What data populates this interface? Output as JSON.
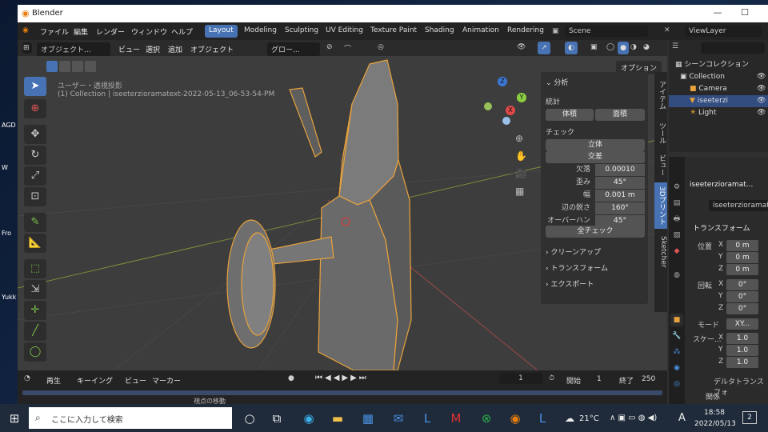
{
  "desktop": {
    "labels": [
      "AGD",
      "W",
      "Fro",
      "Yukk"
    ]
  },
  "window": {
    "title": "Blender",
    "minimize": "—",
    "maximize": "☐"
  },
  "topbar": {
    "menus": [
      "ファイル",
      "編集",
      "レンダー",
      "ウィンドウ",
      "ヘルプ"
    ],
    "workspaces": [
      "Layout",
      "Modeling",
      "Sculpting",
      "UV Editing",
      "Texture Paint",
      "Shading",
      "Animation",
      "Rendering"
    ],
    "active_workspace": "Layout",
    "scene": "Scene",
    "view_layer": "ViewLayer"
  },
  "viewport_header": {
    "mode": "オブジェクト...",
    "menus": [
      "ビュー",
      "選択",
      "追加",
      "オブジェクト"
    ],
    "orientation": "グロー...",
    "options": "オプション"
  },
  "viewport": {
    "overlay_text_1": "ユーザー・透視投影",
    "overlay_text_2": "(1) Collection | iseeterzioramatext-2022-05-13_06-53-54-PM",
    "gizmo": {
      "z": "Z",
      "y": "Y",
      "x": "X"
    }
  },
  "npanel": {
    "section_analysis": "分析",
    "stats_label": "統計",
    "volume_btn": "体積",
    "area_btn": "面積",
    "check_label": "チェック",
    "solid": "立体",
    "intersect": "交差",
    "rows": [
      {
        "label": "欠落",
        "value": "0.00010"
      },
      {
        "label": "歪み",
        "value": "45°"
      },
      {
        "label": "幅",
        "value": "0.001 m"
      },
      {
        "label": "辺の鋭さ",
        "value": "160°"
      },
      {
        "label": "オーバーハング",
        "value": "45°"
      }
    ],
    "check_all": "全チェック",
    "cleanup": "クリーンアップ",
    "transform": "トランスフォーム",
    "export": "エクスポート"
  },
  "ntabs": [
    "アイテム",
    "ツール",
    "ビュー",
    "3Dプリント",
    "Sketcher"
  ],
  "ntabs_active": "3Dプリント",
  "outliner": {
    "scene_collection": "シーンコレクション",
    "items": [
      {
        "name": "Collection",
        "level": 1
      },
      {
        "name": "Camera",
        "level": 2
      },
      {
        "name": "iseeterzi",
        "level": 2,
        "selected": true
      },
      {
        "name": "Light",
        "level": 2
      }
    ]
  },
  "props": {
    "object_name": "iseeterzioramat...",
    "data_name": "iseeterzioramat",
    "transform": "トランスフォーム",
    "location": {
      "label": "位置",
      "x": "0 m",
      "y": "0 m",
      "z": "0 m"
    },
    "rotation": {
      "label": "回転",
      "x": "0°",
      "y": "0°",
      "z": "0°"
    },
    "mode_label": "モード",
    "mode_value": "XY...",
    "scale": {
      "label": "スケー...",
      "x": "1.0",
      "y": "1.0",
      "z": "1.0"
    },
    "delta": "デルタトランスフォ",
    "relations": "関係",
    "axis": {
      "x": "X",
      "y": "Y",
      "z": "Z"
    }
  },
  "timeline": {
    "playback": "再生",
    "keying": "キーイング",
    "view": "ビュー",
    "marker": "マーカー",
    "current_frame": "1",
    "start_label": "開始",
    "start": "1",
    "end_label": "終了",
    "end": "250",
    "status": "視点の移動"
  },
  "taskbar": {
    "search": "ここに入力して検索",
    "temp": "21°C",
    "lang": "A",
    "time": "18:58",
    "date": "2022/05/13",
    "notif": "2"
  }
}
